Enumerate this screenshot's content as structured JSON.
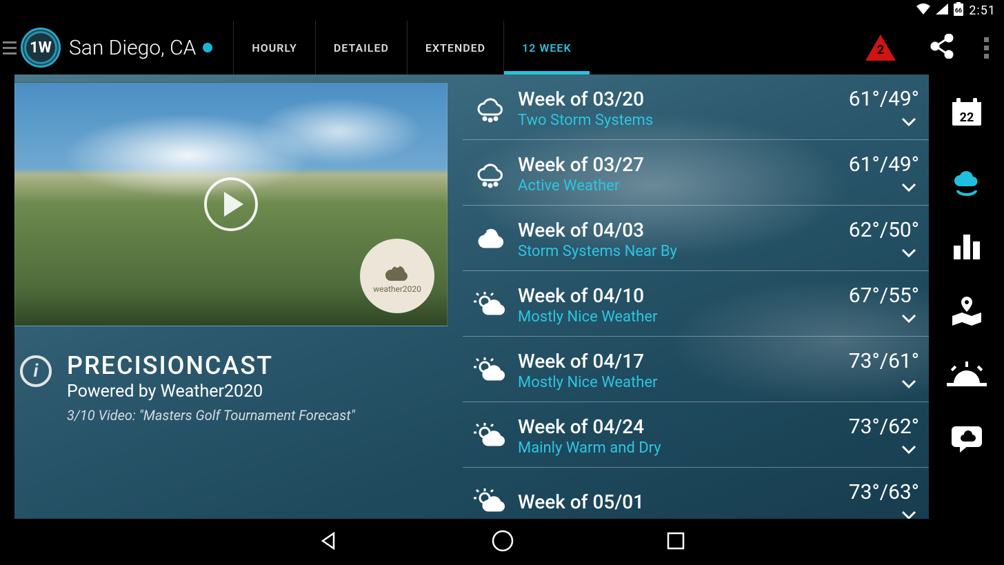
{
  "status": {
    "clock": "2:51",
    "battery": "66"
  },
  "header": {
    "location": "San Diego, CA",
    "tabs": [
      "HOURLY",
      "DETAILED",
      "EXTENDED",
      "12 WEEK"
    ],
    "active_tab": 3,
    "alert_count": "2"
  },
  "video": {
    "badge_label": "weather2020"
  },
  "info": {
    "title": "PRECISIONCAST",
    "subtitle": "Powered by Weather2020",
    "description": "3/10 Video: \"Masters Golf Tournament Forecast\""
  },
  "weeks": [
    {
      "icon": "rain",
      "title": "Week of 03/20",
      "subtitle": "Two Storm Systems",
      "hi": "61°",
      "lo": "49°"
    },
    {
      "icon": "rain",
      "title": "Week of 03/27",
      "subtitle": "Active Weather",
      "hi": "61°",
      "lo": "49°"
    },
    {
      "icon": "showers",
      "title": "Week of 04/03",
      "subtitle": "Storm Systems Near By",
      "hi": "62°",
      "lo": "50°"
    },
    {
      "icon": "partly",
      "title": "Week of 04/10",
      "subtitle": "Mostly Nice Weather",
      "hi": "67°",
      "lo": "55°"
    },
    {
      "icon": "partly",
      "title": "Week of 04/17",
      "subtitle": "Mostly Nice Weather",
      "hi": "73°",
      "lo": "61°"
    },
    {
      "icon": "partly",
      "title": "Week of 04/24",
      "subtitle": "Mainly Warm and Dry",
      "hi": "73°",
      "lo": "62°"
    },
    {
      "icon": "partly",
      "title": "Week of 05/01",
      "subtitle": "",
      "hi": "73°",
      "lo": "63°"
    }
  ],
  "rail": {
    "calendar_day": "22"
  }
}
